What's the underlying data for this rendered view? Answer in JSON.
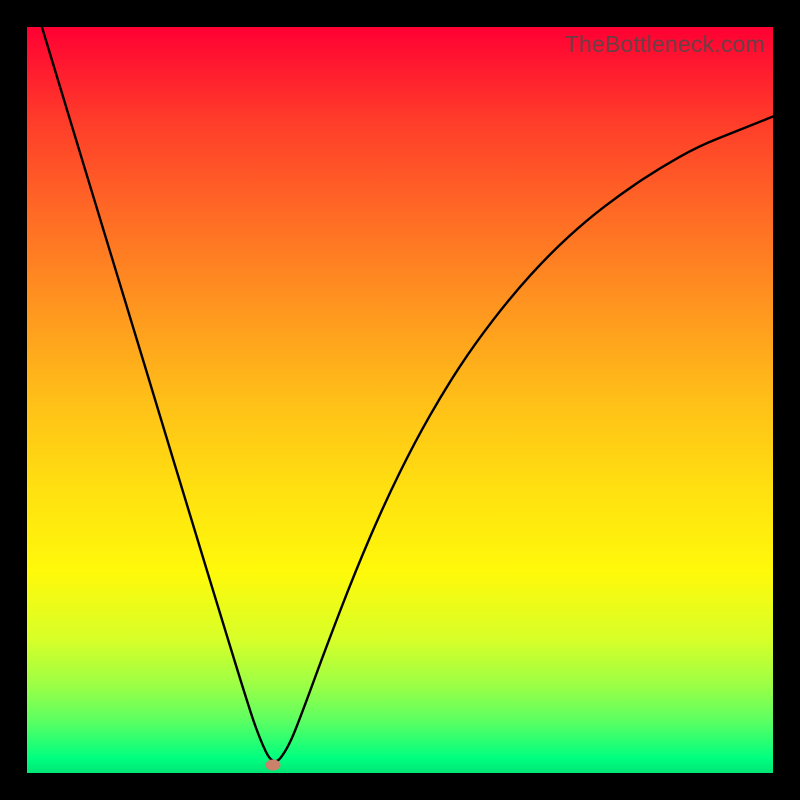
{
  "watermark": "TheBottleneck.com",
  "colors": {
    "frame": "#000000",
    "curve": "#000000",
    "dot": "#cc826a",
    "gradient_top": "#ff0033",
    "gradient_bottom": "#00e676"
  },
  "chart_data": {
    "type": "line",
    "title": "",
    "xlabel": "",
    "ylabel": "",
    "xlim": [
      0,
      1
    ],
    "ylim": [
      0,
      1
    ],
    "series": [
      {
        "name": "bottleneck-curve",
        "x": [
          0.02,
          0.06,
          0.1,
          0.14,
          0.18,
          0.22,
          0.26,
          0.29,
          0.31,
          0.33,
          0.35,
          0.37,
          0.4,
          0.44,
          0.48,
          0.52,
          0.56,
          0.6,
          0.65,
          0.7,
          0.75,
          0.8,
          0.85,
          0.9,
          0.95,
          1.0
        ],
        "y": [
          1.0,
          0.868,
          0.736,
          0.605,
          0.473,
          0.341,
          0.21,
          0.112,
          0.05,
          0.008,
          0.033,
          0.084,
          0.166,
          0.27,
          0.363,
          0.444,
          0.514,
          0.575,
          0.64,
          0.695,
          0.741,
          0.779,
          0.812,
          0.84,
          0.86,
          0.88
        ]
      }
    ],
    "minimum_marker": {
      "x": 0.33,
      "y": 0.011
    },
    "annotations": []
  }
}
